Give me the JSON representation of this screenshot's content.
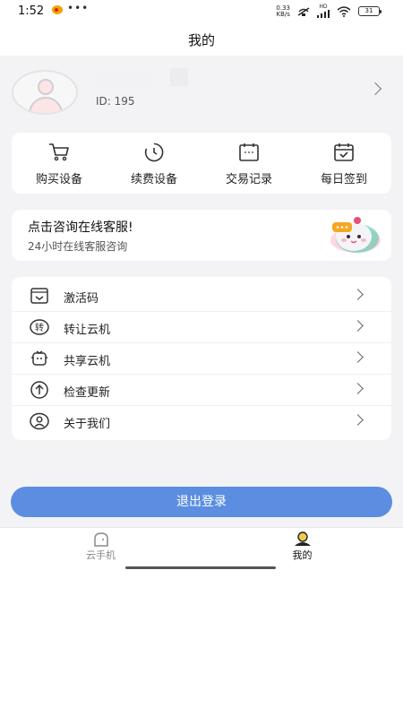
{
  "status_bar": {
    "time": "1:52",
    "net_speed_value": "0.33",
    "net_speed_unit": "KB/s",
    "signal_badge": "HD",
    "battery": "31"
  },
  "nav": {
    "title": "我的"
  },
  "profile": {
    "id_text": "ID: 195"
  },
  "quick_actions": [
    {
      "label": "购买设备",
      "icon": "cart-icon"
    },
    {
      "label": "续费设备",
      "icon": "clock-icon"
    },
    {
      "label": "交易记录",
      "icon": "receipt-icon"
    },
    {
      "label": "每日签到",
      "icon": "calendar-check-icon"
    }
  ],
  "service": {
    "title": "点击咨询在线客服!",
    "subtitle": "24小时在线客服咨询"
  },
  "menu": [
    {
      "label": "激活码",
      "icon": "activation-code-icon"
    },
    {
      "label": "转让云机",
      "icon": "transfer-icon"
    },
    {
      "label": "共享云机",
      "icon": "share-device-icon"
    },
    {
      "label": "检查更新",
      "icon": "update-arrow-icon"
    },
    {
      "label": "关于我们",
      "icon": "about-user-icon"
    }
  ],
  "logout": {
    "label": "退出登录"
  },
  "tabs": [
    {
      "label": "云手机",
      "icon": "cloud-phone-icon",
      "active": false
    },
    {
      "label": "我的",
      "icon": "profile-icon",
      "active": true
    }
  ],
  "colors": {
    "accent": "#5b8ee0",
    "page_bg": "#f3f3f5",
    "tab_active_icon": "#f2c94c"
  }
}
